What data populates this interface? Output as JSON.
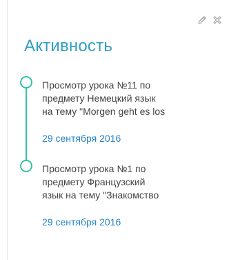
{
  "widget": {
    "title": "Активность",
    "tools": {
      "edit_icon": "pencil-icon",
      "close_icon": "close-x-icon"
    },
    "items": [
      {
        "lines": [
          "Просмотр урока №11 по",
          "предмету Немецкий язык",
          "на тему \"Morgen geht es los"
        ],
        "date": "29 сентября 2016"
      },
      {
        "lines": [
          "Просмотр урока №1 по",
          "предмету Французский",
          "язык на тему \"Знакомство"
        ],
        "date": "29 сентября 2016"
      }
    ]
  },
  "colors": {
    "accent_title": "#2f9ec4",
    "timeline": "#36c2a7",
    "date_link": "#2584c6",
    "text": "#444444",
    "icon": "#9a9a9a"
  }
}
